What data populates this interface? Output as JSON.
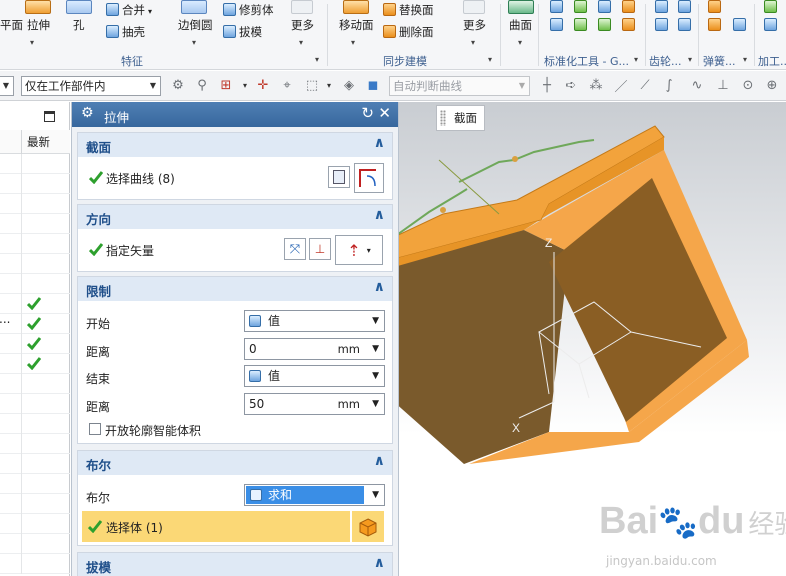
{
  "ribbon": {
    "labels": {
      "plane": "平面",
      "extrude": "拉伸",
      "hole": "孔",
      "unite": "合并",
      "shell": "抽壳",
      "edge_blend": "边倒圆",
      "trim_body": "修剪体",
      "draft": "拔模",
      "more1": "更多",
      "offset_face": "移动面",
      "replace_face": "替换面",
      "delete_face": "删除面",
      "more2": "更多",
      "surface": "曲面"
    },
    "groups": {
      "feature": "特征",
      "sync_modeling": "同步建模",
      "standard_parts": "标准化工具 - G...",
      "gear": "齿轮...",
      "spring": "弹簧...",
      "machining": "加工..."
    }
  },
  "toolbar": {
    "filter_combo": "仅在工作部件内",
    "curve_rule_combo": "自动判断曲线"
  },
  "nav": {
    "header_latest": "最新",
    "ellipsis": "..."
  },
  "dialog": {
    "title": "拉伸",
    "sections": {
      "section": {
        "title": "截面",
        "select_curve": "选择曲线 (8)"
      },
      "direction": {
        "title": "方向",
        "specify_vector": "指定矢量"
      },
      "limits": {
        "title": "限制",
        "start_label": "开始",
        "start_value": "值",
        "distance_label": "距离",
        "start_distance": "0",
        "end_label": "结束",
        "end_value": "值",
        "end_distance": "50",
        "unit": "mm",
        "open_profile": "开放轮廓智能体积"
      },
      "boolean": {
        "title": "布尔",
        "boolean_label": "布尔",
        "boolean_value": "求和",
        "select_body": "选择体 (1)"
      },
      "draft": {
        "title": "拔模"
      }
    }
  },
  "viewport": {
    "tooltip": "截面",
    "axis_z": "Z",
    "axis_x": "X"
  },
  "watermark": {
    "brand": "Bai",
    "brand2": "du",
    "cn": "经验",
    "url": "jingyan.baidu.com"
  },
  "colors": {
    "accent_blue": "#37679d",
    "highlight_yellow": "#fbd876",
    "boolean_blue": "#3a8ee6",
    "body_orange": "#f5a64a",
    "check_green": "#2ea02e"
  }
}
